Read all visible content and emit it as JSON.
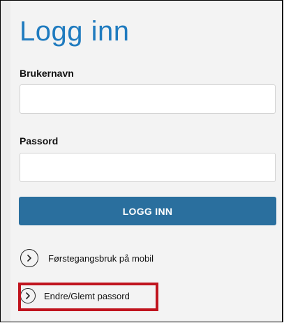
{
  "login": {
    "title": "Logg inn",
    "username_label": "Brukernavn",
    "username_value": "",
    "password_label": "Passord",
    "password_value": "",
    "submit_label": "LOGG INN"
  },
  "links": {
    "first_use": "Førstegangsbruk på mobil",
    "change_password": "Endre/Glemt passord"
  },
  "icons": {
    "link_icon": "chevron-right-circle-icon"
  },
  "colors": {
    "title": "#1f7bbf",
    "button": "#2a6f9e",
    "highlight": "#c0141e"
  }
}
